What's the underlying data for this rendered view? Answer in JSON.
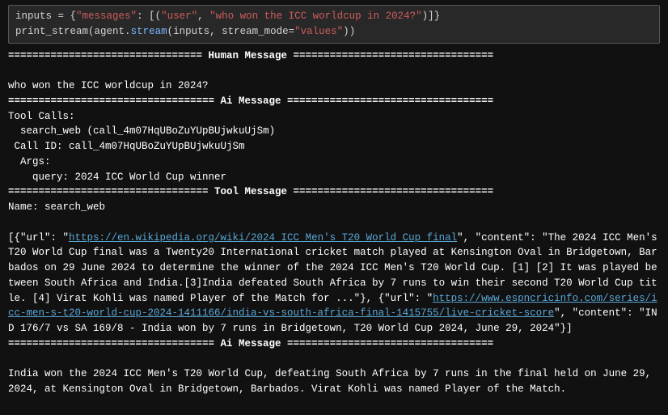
{
  "code": {
    "var_inputs": "inputs",
    "eq": " = ",
    "brace_open": "{",
    "key_messages": "\"messages\"",
    "colon": ": ",
    "list_open": "[(",
    "val_user": "\"user\"",
    "comma": ", ",
    "val_question": "\"who won the ICC worldcup in 2024?\"",
    "list_close": ")]",
    "brace_close": "}",
    "fn_print_stream": "print_stream",
    "paren_open": "(",
    "var_agent": "agent",
    "dot": ".",
    "method_stream": "stream",
    "args_inner_open": "(",
    "var_inputs2": "inputs",
    "kw_stream_mode": "stream_mode",
    "eq2": "=",
    "val_values": "\"values\"",
    "args_inner_close": ")",
    "paren_close": ")"
  },
  "output": {
    "human_header": "================================ Human Message =================================",
    "blank": "",
    "human_text": "who won the ICC worldcup in 2024?",
    "ai_header1": "================================== Ai Message ==================================",
    "tool_calls_label": "Tool Calls:",
    "tool_call_line": "  search_web (call_4m07HqUBoZuYUpBUjwkuUjSm)",
    "call_id_line": " Call ID: call_4m07HqUBoZuYUpBUjwkuUjSm",
    "args_label": "  Args:",
    "args_query": "    query: 2024 ICC World Cup winner",
    "tool_header": "================================= Tool Message =================================",
    "tool_name": "Name: search_web",
    "json_prefix": "[{\"url\": \"",
    "url1": "https://en.wikipedia.org/wiki/2024_ICC_Men's_T20_World_Cup_final",
    "json_mid1": "\", \"content\": \"The 2024 ICC Men's T20 World Cup final was a Twenty20 International cricket match played at Kensington Oval in Bridgetown, Barbados on 29 June 2024 to determine the winner of the 2024 ICC Men's T20 World Cup. [1] [2] It was played between South Africa and India.[3]India defeated South Africa by 7 runs to win their second T20 World Cup title. [4] Virat Kohli was named Player of the Match for ...\"}, {\"url\": \"",
    "url2": "https://www.espncricinfo.com/series/icc-men-s-t20-world-cup-2024-1411166/india-vs-south-africa-final-1415755/live-cricket-score",
    "json_suffix": "\", \"content\": \"IND 176/7 vs SA 169/8 - India won by 7 runs in Bridgetown, T20 World Cup 2024, June 29, 2024\"}]",
    "ai_header2": "================================== Ai Message ==================================",
    "final_answer": "India won the 2024 ICC Men's T20 World Cup, defeating South Africa by 7 runs in the final held on June 29, 2024, at Kensington Oval in Bridgetown, Barbados. Virat Kohli was named Player of the Match."
  }
}
